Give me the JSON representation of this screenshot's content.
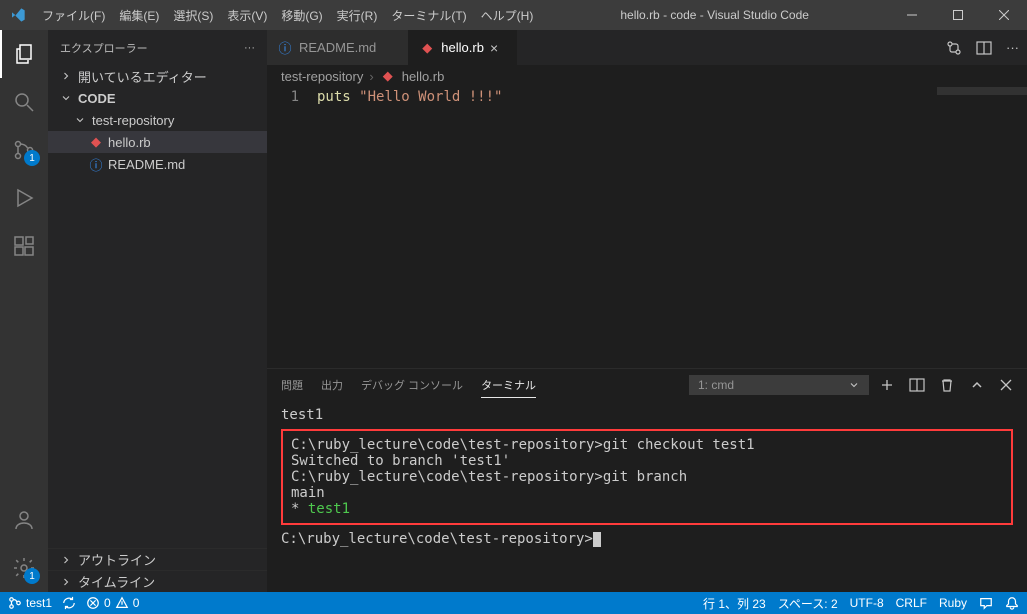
{
  "titlebar": {
    "menus": [
      "ファイル(F)",
      "編集(E)",
      "選択(S)",
      "表示(V)",
      "移動(G)",
      "実行(R)",
      "ターミナル(T)",
      "ヘルプ(H)"
    ],
    "title": "hello.rb - code - Visual Studio Code"
  },
  "sidebar": {
    "title": "エクスプローラー",
    "open_editors": "開いているエディター",
    "root": "CODE",
    "folder1": "test-repository",
    "files": {
      "hello": "hello.rb",
      "readme": "README.md"
    },
    "outline": "アウトライン",
    "timeline": "タイムライン"
  },
  "tabs": {
    "readme": "README.md",
    "hello": "hello.rb"
  },
  "breadcrumbs": {
    "folder": "test-repository",
    "file": "hello.rb"
  },
  "code": {
    "line1_number": "1",
    "line1_puts": "puts",
    "line1_space": " ",
    "line1_string": "\"Hello World !!!\""
  },
  "panel": {
    "tabs": {
      "problems": "問題",
      "output": "出力",
      "debug": "デバッグ コンソール",
      "terminal": "ターミナル"
    },
    "select_label": "1: cmd"
  },
  "terminal": {
    "pre": " test1",
    "l1": "C:\\ruby_lecture\\code\\test-repository>git checkout test1",
    "l2": "Switched to branch 'test1'",
    "l3": "",
    "l4": "C:\\ruby_lecture\\code\\test-repository>git branch",
    "l5": "  main",
    "l6_prefix": "* ",
    "l6_branch": "test1",
    "prompt": "C:\\ruby_lecture\\code\\test-repository>"
  },
  "activity_badges": {
    "scm": "1",
    "settings": "1"
  },
  "statusbar": {
    "branch": "test1",
    "sync": "",
    "errors": "0",
    "warnings": "0",
    "ln_col": "行 1、列 23",
    "spaces": "スペース: 2",
    "encoding": "UTF-8",
    "eol": "CRLF",
    "lang": "Ruby"
  }
}
